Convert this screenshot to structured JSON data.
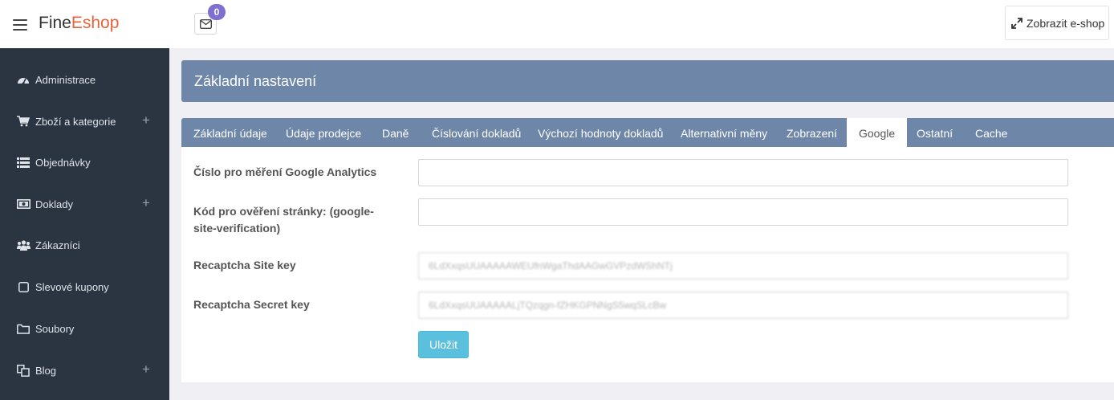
{
  "brand": {
    "part1": "Fine",
    "part2": "Eshop"
  },
  "mail": {
    "badge": "0"
  },
  "topbar": {
    "eshop_button": "Zobrazit e-shop"
  },
  "sidebar": {
    "items": [
      {
        "label": "Administrace",
        "icon": "dashboard-icon",
        "expandable": false
      },
      {
        "label": "Zboží a kategorie",
        "icon": "shopping-cart-icon",
        "expandable": true
      },
      {
        "label": "Objednávky",
        "icon": "list-icon",
        "expandable": false
      },
      {
        "label": "Doklady",
        "icon": "money-icon",
        "expandable": true
      },
      {
        "label": "Zákazníci",
        "icon": "users-icon",
        "expandable": false
      },
      {
        "label": "Slevové kupony",
        "icon": "square-icon",
        "expandable": false
      },
      {
        "label": "Soubory",
        "icon": "folder-icon",
        "expandable": false
      },
      {
        "label": "Blog",
        "icon": "copy-icon",
        "expandable": true
      }
    ],
    "expand_symbol": "+"
  },
  "page": {
    "title": "Základní nastavení"
  },
  "tabs": [
    {
      "label": "Základní údaje",
      "active": false
    },
    {
      "label": "Údaje prodejce",
      "active": false
    },
    {
      "label": "Daně",
      "active": false
    },
    {
      "label": "Číslování dokladů",
      "active": false
    },
    {
      "label": "Výchozí hodnoty dokladů",
      "active": false
    },
    {
      "label": "Alternativní měny",
      "active": false
    },
    {
      "label": "Zobrazení",
      "active": false
    },
    {
      "label": "Google",
      "active": true
    },
    {
      "label": "Ostatní",
      "active": false
    },
    {
      "label": "Cache",
      "active": false
    }
  ],
  "form": {
    "analytics": {
      "label": "Číslo pro měření Google Analytics",
      "value": ""
    },
    "verification": {
      "label": "Kód pro ověření stránky: (google-site-verification)",
      "value": ""
    },
    "site_key": {
      "label": "Recaptcha Site key",
      "value": "6LdXxqsUUAAAAAWEUfnWgaThdAAGwGVPzdWShNTj"
    },
    "secret_key": {
      "label": "Recaptcha Secret key",
      "value": "6LdXxqsUUAAAAALjTQzqgn-fZHKGPNNgS5wqSLcBw"
    },
    "save_label": "Uložit"
  },
  "colors": {
    "sidebar_bg": "#2b3441",
    "header_bg": "#6e86a7",
    "brand_accent": "#e7643b",
    "badge": "#7e6fd0",
    "save_button": "#5bc0de"
  }
}
